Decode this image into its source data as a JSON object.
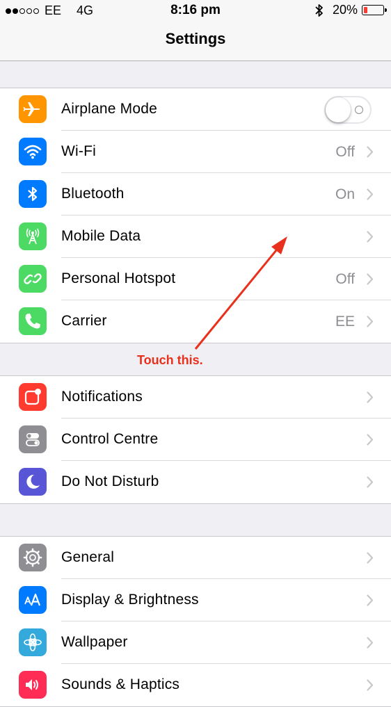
{
  "status_bar": {
    "carrier": "EE",
    "network": "4G",
    "time": "8:16 pm",
    "battery_percent_label": "20%",
    "battery_level": 0.2,
    "battery_color": "#ff3b30"
  },
  "nav": {
    "title": "Settings"
  },
  "groups": [
    {
      "items": [
        {
          "label": "Airplane Mode",
          "icon": "airplane-icon",
          "icon_bg": "#ff9500",
          "control": "toggle",
          "toggle_on": false
        },
        {
          "label": "Wi-Fi",
          "icon": "wifi-icon",
          "icon_bg": "#007aff",
          "value": "Off"
        },
        {
          "label": "Bluetooth",
          "icon": "bluetooth-icon",
          "icon_bg": "#007aff",
          "value": "On"
        },
        {
          "label": "Mobile Data",
          "icon": "antenna-icon",
          "icon_bg": "#4cd964",
          "value": ""
        },
        {
          "label": "Personal Hotspot",
          "icon": "hotspot-link-icon",
          "icon_bg": "#4cd964",
          "value": "Off"
        },
        {
          "label": "Carrier",
          "icon": "phone-icon",
          "icon_bg": "#4cd964",
          "value": "EE"
        }
      ]
    },
    {
      "items": [
        {
          "label": "Notifications",
          "icon": "notifications-icon",
          "icon_bg": "#ff3b30",
          "value": ""
        },
        {
          "label": "Control Centre",
          "icon": "control-centre-icon",
          "icon_bg": "#8e8e93",
          "value": ""
        },
        {
          "label": "Do Not Disturb",
          "icon": "moon-icon",
          "icon_bg": "#5856d6",
          "value": ""
        }
      ]
    },
    {
      "items": [
        {
          "label": "General",
          "icon": "gear-icon",
          "icon_bg": "#8e8e93",
          "value": ""
        },
        {
          "label": "Display & Brightness",
          "icon": "text-size-icon",
          "icon_bg": "#007aff",
          "value": ""
        },
        {
          "label": "Wallpaper",
          "icon": "flower-icon",
          "icon_bg": "#34aadc",
          "value": ""
        },
        {
          "label": "Sounds & Haptics",
          "icon": "speaker-icon",
          "icon_bg": "#ff2d55",
          "value": ""
        }
      ]
    }
  ],
  "annotation": {
    "text": "Touch this.",
    "color": "#e8301c"
  }
}
